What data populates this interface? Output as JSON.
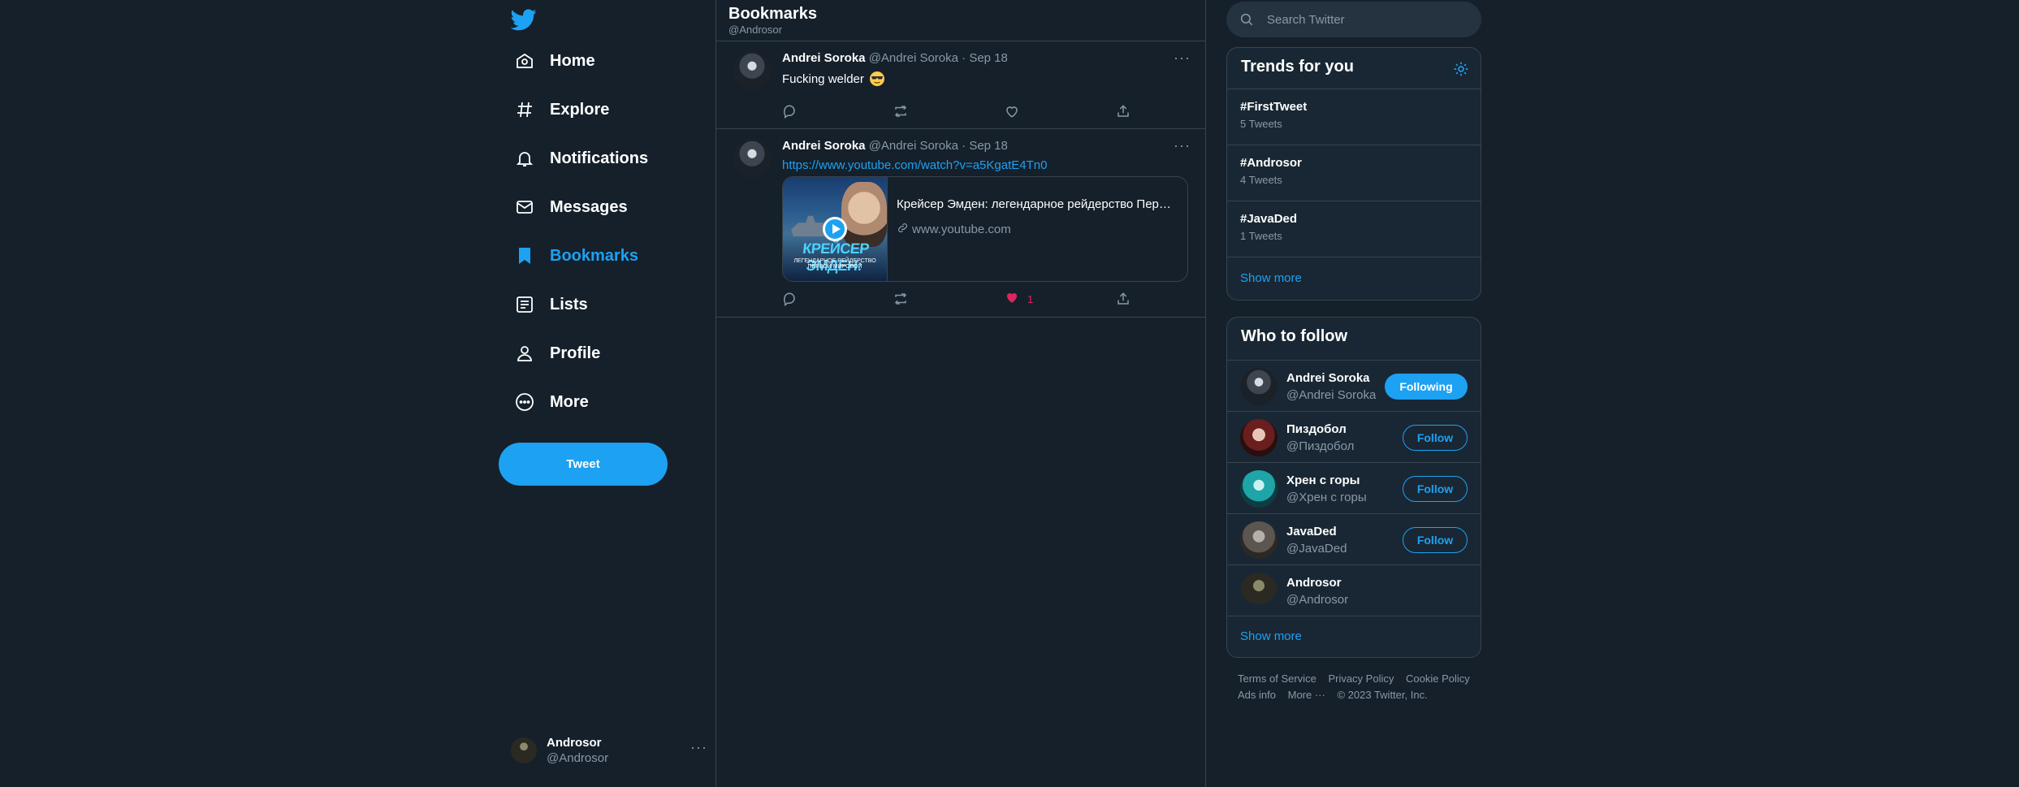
{
  "nav": {
    "items": [
      {
        "label": "Home",
        "icon": "home-icon"
      },
      {
        "label": "Explore",
        "icon": "hashtag-icon"
      },
      {
        "label": "Notifications",
        "icon": "bell-icon"
      },
      {
        "label": "Messages",
        "icon": "envelope-icon"
      },
      {
        "label": "Bookmarks",
        "icon": "bookmark-icon",
        "active": true
      },
      {
        "label": "Lists",
        "icon": "list-icon"
      },
      {
        "label": "Profile",
        "icon": "person-icon"
      },
      {
        "label": "More",
        "icon": "more-circle-icon"
      }
    ],
    "tweet_button": "Tweet",
    "account": {
      "name": "Androsor",
      "handle": "@Androsor"
    }
  },
  "header": {
    "title": "Bookmarks",
    "subtitle": "@Androsor"
  },
  "tweets": [
    {
      "name": "Andrei Soroka",
      "meta": "@Andrei Soroka · Sep 18",
      "text": "Fucking welder",
      "emoji": "sunglasses-emoji"
    },
    {
      "name": "Andrei Soroka",
      "meta": "@Andrei Soroka · Sep 18",
      "link": "https://www.youtube.com/watch?v=a5KgatE4Tn0",
      "card": {
        "title": "Крейсер Эмден: легендарное рейдерство Первой мировой",
        "domain": "www.youtube.com",
        "thumb_text": "КРЕЙСЕР ЭМДЕН:",
        "thumb_sub": "ЛЕГЕНДАРНОЕ РЕЙДЕРСТВО ПЕРВОЙ МИРОВОЙ"
      },
      "likes": "1"
    }
  ],
  "search": {
    "placeholder": "Search Twitter"
  },
  "trends": {
    "title": "Trends for you",
    "items": [
      {
        "name": "#FirstTweet",
        "count": "5 Tweets"
      },
      {
        "name": "#Androsor",
        "count": "4 Tweets"
      },
      {
        "name": "#JavaDed",
        "count": "1 Tweets"
      }
    ],
    "show_more": "Show more"
  },
  "who_to_follow": {
    "title": "Who to follow",
    "items": [
      {
        "name": "Andrei Soroka",
        "handle": "@Andrei Soroka",
        "button": "Following"
      },
      {
        "name": "Пиздобол",
        "handle": "@Пиздобол",
        "button": "Follow"
      },
      {
        "name": "Хрен с горы",
        "handle": "@Хрен с горы",
        "button": "Follow"
      },
      {
        "name": "JavaDed",
        "handle": "@JavaDed",
        "button": "Follow"
      },
      {
        "name": "Androsor",
        "handle": "@Androsor"
      }
    ],
    "show_more": "Show more"
  },
  "footer": {
    "terms": "Terms of Service",
    "privacy": "Privacy Policy",
    "cookie": "Cookie Policy",
    "ads": "Ads info",
    "more": "More ···",
    "copyright": "© 2023 Twitter, Inc."
  },
  "colors": {
    "background": "#15202b",
    "accent": "#1da1f2",
    "like": "#e0245e",
    "muted": "#8899a6",
    "border": "#38444d"
  }
}
